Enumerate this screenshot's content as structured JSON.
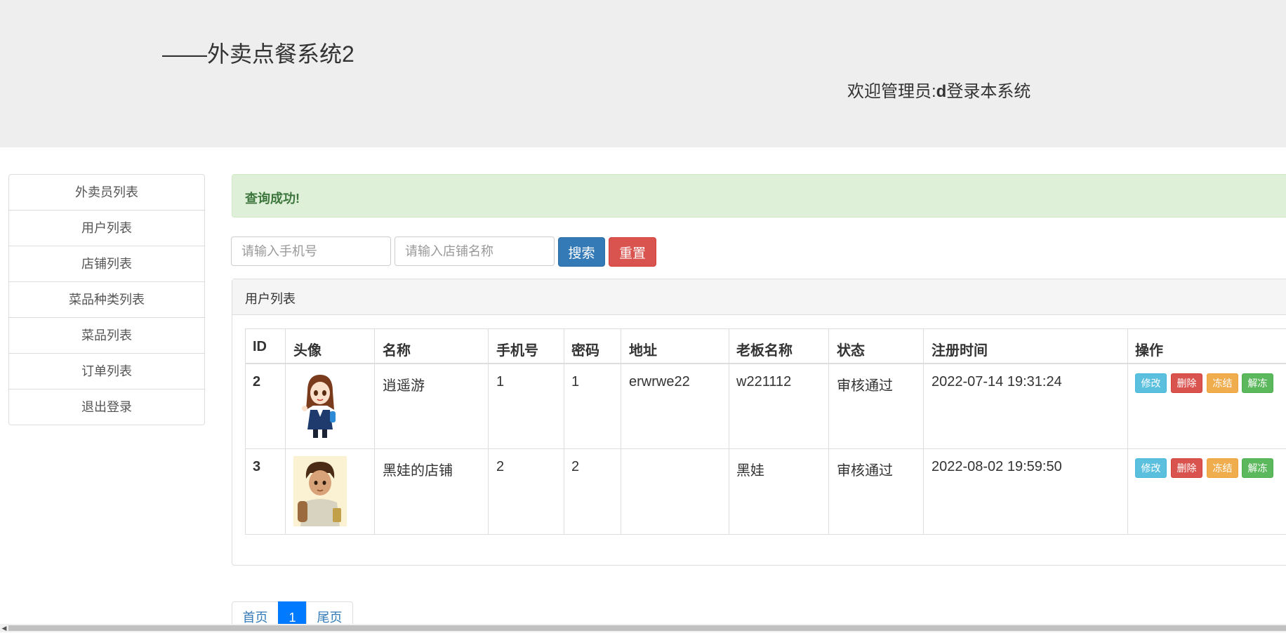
{
  "header": {
    "title": "——外卖点餐系统2",
    "welcome_prefix": "欢迎管理员:",
    "admin_name": "d",
    "welcome_suffix": "登录本系统"
  },
  "sidebar": {
    "items": [
      {
        "label": "外卖员列表"
      },
      {
        "label": "用户列表"
      },
      {
        "label": "店铺列表"
      },
      {
        "label": "菜品种类列表"
      },
      {
        "label": "菜品列表"
      },
      {
        "label": "订单列表"
      },
      {
        "label": "退出登录"
      }
    ]
  },
  "alert": {
    "message": "查询成功!"
  },
  "search": {
    "phone_placeholder": "请输入手机号",
    "shop_placeholder": "请输入店铺名称",
    "phone_value": "",
    "shop_value": "",
    "search_label": "搜索",
    "reset_label": "重置"
  },
  "panel": {
    "title": "用户列表"
  },
  "table": {
    "columns": [
      "ID",
      "头像",
      "名称",
      "手机号",
      "密码",
      "地址",
      "老板名称",
      "状态",
      "注册时间",
      "操作"
    ],
    "rows": [
      {
        "id": "2",
        "avatar": "girl-avatar",
        "name": "逍遥游",
        "phone": "1",
        "password": "1",
        "address": "erwrwe22",
        "owner": "w221112",
        "status": "审核通过",
        "registered": "2022-07-14 19:31:24"
      },
      {
        "id": "3",
        "avatar": "boy-avatar",
        "name": "黑娃的店铺",
        "phone": "2",
        "password": "2",
        "address": "",
        "owner": "黑娃",
        "status": "审核通过",
        "registered": "2022-08-02 19:59:50"
      }
    ],
    "actions": {
      "edit": "修改",
      "delete": "删除",
      "freeze": "冻结",
      "unfreeze": "解冻"
    }
  },
  "pagination": {
    "first": "首页",
    "current": "1",
    "last": "尾页"
  },
  "colors": {
    "header_bg": "#eeeeee",
    "success_bg": "#dff0d8",
    "success_text": "#3c763d",
    "primary": "#337ab7",
    "danger": "#d9534f",
    "info": "#5bc0de",
    "warning": "#f0ad4e",
    "success": "#5cb85c",
    "page_active": "#007bff"
  }
}
